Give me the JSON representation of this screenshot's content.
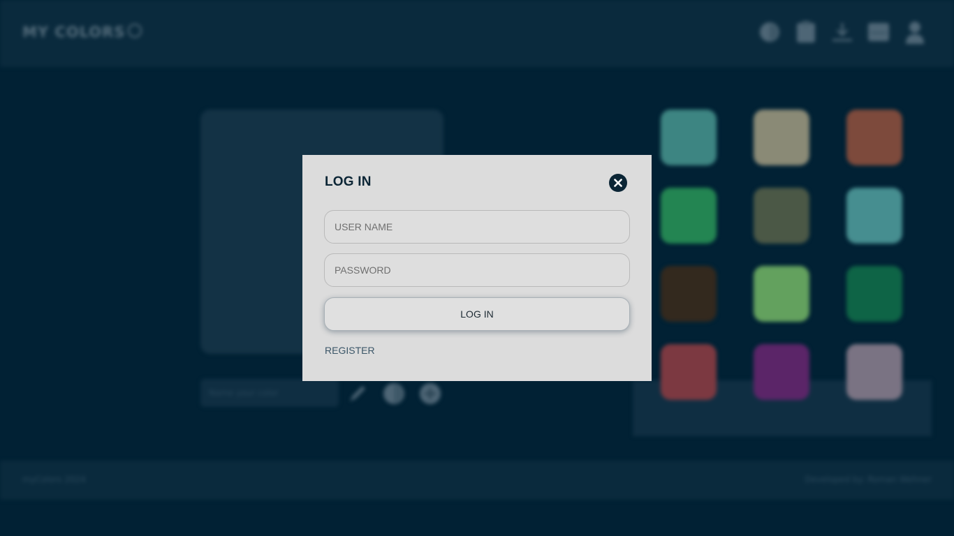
{
  "app": {
    "brand": "MY COLORS",
    "footer_left": "myColors 2024",
    "footer_right": "Developed by: Roman Wehner",
    "name_input_placeholder": "Name your color",
    "swatches": [
      "#3d8582",
      "#8a8a76",
      "#7d4a3c",
      "#238552",
      "#4b5846",
      "#468e90",
      "#33291e",
      "#63a15e",
      "#0e6446",
      "#7c3941",
      "#5b2568",
      "#7a7383"
    ],
    "header_icons": [
      "palette-icon",
      "clipboard-icon",
      "download-icon",
      "inbox-icon",
      "user-icon"
    ],
    "tool_icons": [
      "pencil-icon",
      "palette-icon",
      "add-icon"
    ]
  },
  "modal": {
    "title": "LOG IN",
    "username_placeholder": "USER NAME",
    "password_placeholder": "PASSWORD",
    "submit_label": "LOG IN",
    "register_label": "REGISTER",
    "close_icon": "close-icon"
  },
  "colors": {
    "overlay_bg": "#012134",
    "modal_bg": "#dcdcdc",
    "accent_dark": "#0b2535"
  }
}
